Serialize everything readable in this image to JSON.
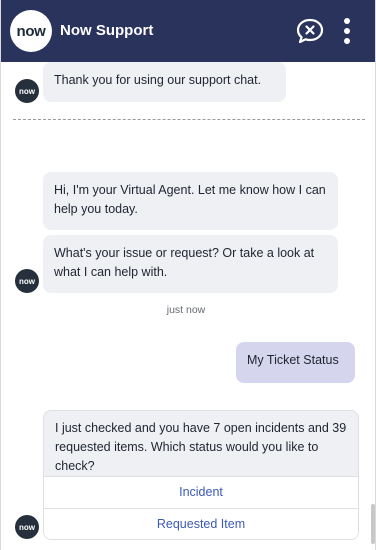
{
  "header": {
    "logo_text": "now",
    "title": "Now Support",
    "end_chat_icon": "chat-bubble-x-icon",
    "more_icon": "vertical-ellipsis-icon",
    "background_color": "#29335c"
  },
  "messages": {
    "previous": "Thank you for using our support chat.",
    "greeting": "Hi, I'm your Virtual Agent. Let me know how I can help you today.",
    "question": "What's your issue or request? Or take a look at what I can help with.",
    "timestamp": "just now",
    "user_message": "My Ticket Status",
    "status_prompt": "I just checked and you have 7 open incidents and 39 requested items.  Which status would you like to check?"
  },
  "choices": [
    {
      "label": "Incident"
    },
    {
      "label": "Requested Item"
    }
  ],
  "avatar": {
    "text": "now"
  },
  "colors": {
    "agent_bubble": "#eef0f3",
    "user_bubble": "#d5d5ee",
    "link": "#3c5ab8"
  }
}
